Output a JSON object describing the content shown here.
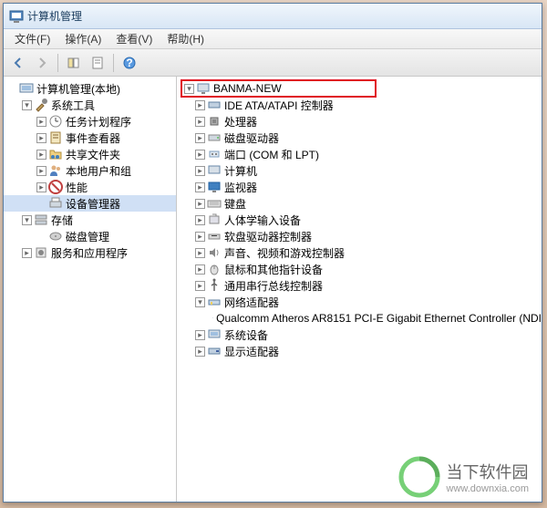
{
  "window": {
    "title": "计算机管理"
  },
  "menubar": {
    "file": "文件(F)",
    "action": "操作(A)",
    "view": "查看(V)",
    "help": "帮助(H)"
  },
  "leftTree": {
    "root": "计算机管理(本地)",
    "systemTools": "系统工具",
    "taskScheduler": "任务计划程序",
    "eventViewer": "事件查看器",
    "sharedFolders": "共享文件夹",
    "localUsers": "本地用户和组",
    "performance": "性能",
    "deviceManager": "设备管理器",
    "storage": "存储",
    "diskManagement": "磁盘管理",
    "services": "服务和应用程序"
  },
  "rightTree": {
    "computerName": "BANMA-NEW",
    "ideAta": "IDE ATA/ATAPI 控制器",
    "processors": "处理器",
    "diskDrives": "磁盘驱动器",
    "ports": "端口 (COM 和 LPT)",
    "computer": "计算机",
    "monitors": "监视器",
    "keyboards": "键盘",
    "hid": "人体学输入设备",
    "floppyController": "软盘驱动器控制器",
    "sound": "声音、视频和游戏控制器",
    "mice": "鼠标和其他指针设备",
    "usb": "通用串行总线控制器",
    "networkAdapters": "网络适配器",
    "networkDevice": "Qualcomm Atheros AR8151 PCI-E Gigabit Ethernet Controller (NDI",
    "systemDevices": "系统设备",
    "displayAdapters": "显示适配器"
  },
  "toolbar": {
    "back": "back",
    "forward": "forward"
  },
  "watermark": {
    "title": "当下软件园",
    "url": "www.downxia.com"
  }
}
